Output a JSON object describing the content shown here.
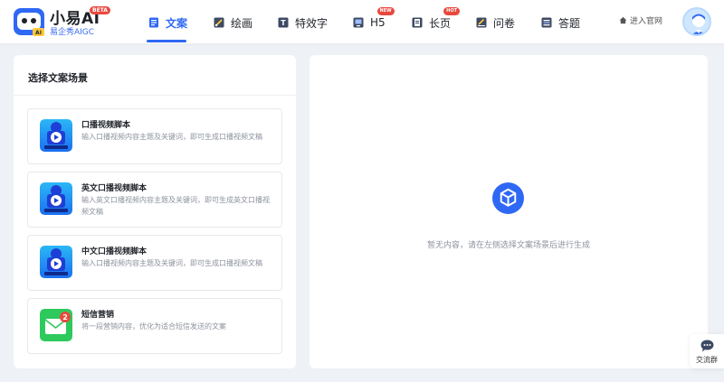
{
  "brand": {
    "title": "小易AI",
    "beta": "BETA",
    "subtitle": "易企秀AIGC",
    "logo_icon": "robot-logo-icon"
  },
  "nav": {
    "items": [
      {
        "label": "文案",
        "icon": "document-icon",
        "active": true
      },
      {
        "label": "绘画",
        "icon": "paint-icon"
      },
      {
        "label": "特效字",
        "icon": "effect-text-icon"
      },
      {
        "label": "H5",
        "icon": "h5-icon",
        "badge": "NEW"
      },
      {
        "label": "长页",
        "icon": "long-page-icon",
        "badge": "HOT"
      },
      {
        "label": "问卷",
        "icon": "survey-icon"
      },
      {
        "label": "答题",
        "icon": "quiz-icon"
      }
    ],
    "official_link": "进入官网"
  },
  "left_panel": {
    "title": "选择文案场景",
    "scenes": [
      {
        "name": "口播视频脚本",
        "desc": "输入口播视频内容主题及关键词，即可生成口播视频文稿",
        "icon": "video-script-icon"
      },
      {
        "name": "英文口播视频脚本",
        "desc": "输入英文口播视频内容主题及关键词，即可生成英文口播视频文稿",
        "icon": "video-script-icon"
      },
      {
        "name": "中文口播视频脚本",
        "desc": "输入口播视频内容主题及关键词，即可生成口播视频文稿",
        "icon": "video-script-icon"
      },
      {
        "name": "短信营销",
        "desc": "将一段营销内容，优化为适合短信发送的文案",
        "icon": "sms-icon",
        "icon_badge": "2"
      }
    ]
  },
  "right_panel": {
    "empty_text": "暂无内容，请在左侧选择文案场景后进行生成",
    "empty_icon": "cube-icon"
  },
  "float_button": {
    "label": "交流群",
    "icon": "chat-icon"
  },
  "colors": {
    "accent": "#2f68f5",
    "badge_red": "#e8493f",
    "background": "#eef1f6"
  }
}
